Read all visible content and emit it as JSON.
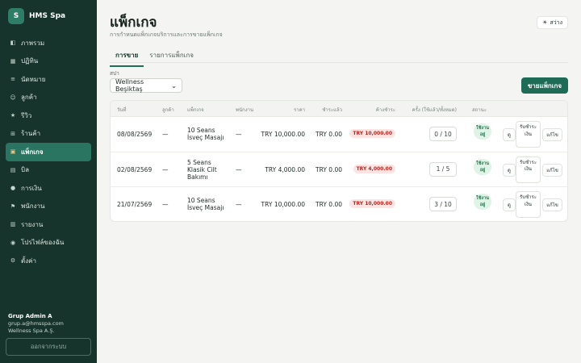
{
  "app": {
    "logo_letter": "S",
    "name": "HMS Spa"
  },
  "sidebar": {
    "items": [
      {
        "icon": "dashboard-icon",
        "glyph": "◧",
        "label": "ภาพรวม"
      },
      {
        "icon": "calendar-icon",
        "glyph": "▦",
        "label": "ปฏิทิน"
      },
      {
        "icon": "appointments-icon",
        "glyph": "≡",
        "label": "นัดหมาย"
      },
      {
        "icon": "customers-icon",
        "glyph": "☺",
        "label": "ลูกค้า"
      },
      {
        "icon": "star-icon",
        "glyph": "★",
        "label": "รีวิว"
      },
      {
        "icon": "cart-icon",
        "glyph": "⊞",
        "label": "ร้านค้า"
      },
      {
        "icon": "gift-icon",
        "glyph": "▣",
        "label": "แพ็กเกจ"
      },
      {
        "icon": "bill-icon",
        "glyph": "▤",
        "label": "บิล"
      },
      {
        "icon": "money-bag-icon",
        "glyph": "●",
        "label": "การเงิน"
      },
      {
        "icon": "flag-icon",
        "glyph": "⚑",
        "label": "พนักงาน"
      },
      {
        "icon": "report-icon",
        "glyph": "▥",
        "label": "รายงาน"
      },
      {
        "icon": "user-icon",
        "glyph": "◉",
        "label": "โปรไฟล์ของฉัน"
      },
      {
        "icon": "gear-icon",
        "glyph": "⚙",
        "label": "ตั้งค่า"
      }
    ],
    "active_index": 6,
    "user": {
      "name": "Grup Admin A",
      "email": "grup.a@hmsspa.com",
      "company": "Wellness Spa A.Ş."
    },
    "logout_label": "ออกจากระบบ"
  },
  "header": {
    "title": "แพ็กเกจ",
    "subtitle": "การกำหนดแพ็กเกจบริการและการขายแพ็กเกจ",
    "theme_label": "สว่าง",
    "theme_glyph": "☀"
  },
  "tabs": [
    {
      "label": "การขาย",
      "active": true
    },
    {
      "label": "รายการแพ็กเกจ",
      "active": false
    }
  ],
  "filter": {
    "branch_label": "สปา",
    "branch_value": "Wellness Beşiktaş"
  },
  "sell_button_label": "ขายแพ็กเกจ",
  "table": {
    "headers": [
      "วันที่",
      "ลูกค้า",
      "แพ็กเกจ",
      "พนักงาน",
      "ราคา",
      "ชำระแล้ว",
      "ค้างชำระ",
      "ครั้ง (ใช้แล้ว/ทั้งหมด)",
      "สถานะ"
    ],
    "rows": [
      {
        "date": "08/08/2569",
        "customer": "—",
        "package": "10 Seans İsveç Masajı",
        "staff": "—",
        "price": "TRY 10,000.00",
        "paid": "TRY 0.00",
        "due": "TRY 10,000.00",
        "uses": "0 / 10",
        "status": "ใช้งานอยู่"
      },
      {
        "date": "02/08/2569",
        "customer": "—",
        "package": "5 Seans Klasik Cilt Bakımı",
        "staff": "—",
        "price": "TRY 4,000.00",
        "paid": "TRY 0.00",
        "due": "TRY 4,000.00",
        "uses": "1 / 5",
        "status": "ใช้งานอยู่"
      },
      {
        "date": "21/07/2569",
        "customer": "—",
        "package": "10 Seans İsveç Masajı",
        "staff": "—",
        "price": "TRY 10,000.00",
        "paid": "TRY 0.00",
        "due": "TRY 10,000.00",
        "uses": "3 / 10",
        "status": "ใช้งานอยู่"
      }
    ],
    "actions": {
      "view": "ดู",
      "pay": "รับชำระเงิน",
      "edit": "แก้ไข"
    }
  },
  "colors": {
    "sidebar_bg": "#16332c",
    "accent": "#1e6b56",
    "active_item": "#2a7561",
    "due_badge": "#b3261e",
    "status_badge": "#1d7a4e"
  }
}
